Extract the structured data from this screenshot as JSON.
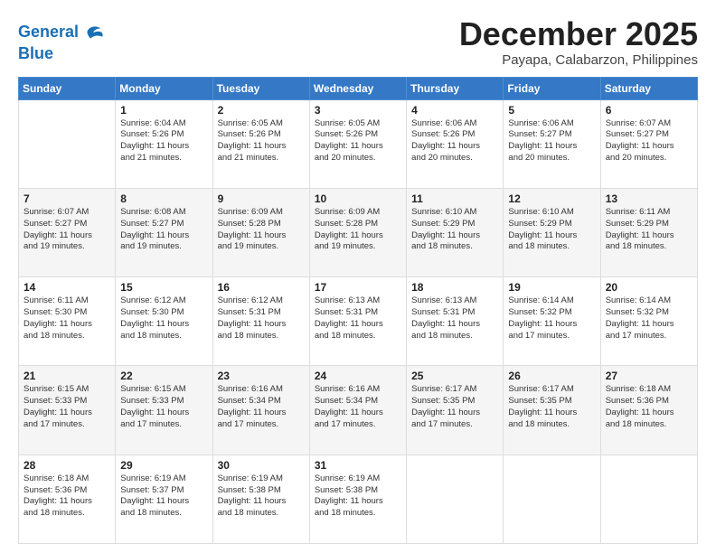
{
  "header": {
    "logo_line1": "General",
    "logo_line2": "Blue",
    "month": "December 2025",
    "location": "Payapa, Calabarzon, Philippines"
  },
  "days_of_week": [
    "Sunday",
    "Monday",
    "Tuesday",
    "Wednesday",
    "Thursday",
    "Friday",
    "Saturday"
  ],
  "weeks": [
    [
      {
        "day": "",
        "info": ""
      },
      {
        "day": "1",
        "info": "Sunrise: 6:04 AM\nSunset: 5:26 PM\nDaylight: 11 hours\nand 21 minutes."
      },
      {
        "day": "2",
        "info": "Sunrise: 6:05 AM\nSunset: 5:26 PM\nDaylight: 11 hours\nand 21 minutes."
      },
      {
        "day": "3",
        "info": "Sunrise: 6:05 AM\nSunset: 5:26 PM\nDaylight: 11 hours\nand 20 minutes."
      },
      {
        "day": "4",
        "info": "Sunrise: 6:06 AM\nSunset: 5:26 PM\nDaylight: 11 hours\nand 20 minutes."
      },
      {
        "day": "5",
        "info": "Sunrise: 6:06 AM\nSunset: 5:27 PM\nDaylight: 11 hours\nand 20 minutes."
      },
      {
        "day": "6",
        "info": "Sunrise: 6:07 AM\nSunset: 5:27 PM\nDaylight: 11 hours\nand 20 minutes."
      }
    ],
    [
      {
        "day": "7",
        "info": "Sunrise: 6:07 AM\nSunset: 5:27 PM\nDaylight: 11 hours\nand 19 minutes."
      },
      {
        "day": "8",
        "info": "Sunrise: 6:08 AM\nSunset: 5:27 PM\nDaylight: 11 hours\nand 19 minutes."
      },
      {
        "day": "9",
        "info": "Sunrise: 6:09 AM\nSunset: 5:28 PM\nDaylight: 11 hours\nand 19 minutes."
      },
      {
        "day": "10",
        "info": "Sunrise: 6:09 AM\nSunset: 5:28 PM\nDaylight: 11 hours\nand 19 minutes."
      },
      {
        "day": "11",
        "info": "Sunrise: 6:10 AM\nSunset: 5:29 PM\nDaylight: 11 hours\nand 18 minutes."
      },
      {
        "day": "12",
        "info": "Sunrise: 6:10 AM\nSunset: 5:29 PM\nDaylight: 11 hours\nand 18 minutes."
      },
      {
        "day": "13",
        "info": "Sunrise: 6:11 AM\nSunset: 5:29 PM\nDaylight: 11 hours\nand 18 minutes."
      }
    ],
    [
      {
        "day": "14",
        "info": "Sunrise: 6:11 AM\nSunset: 5:30 PM\nDaylight: 11 hours\nand 18 minutes."
      },
      {
        "day": "15",
        "info": "Sunrise: 6:12 AM\nSunset: 5:30 PM\nDaylight: 11 hours\nand 18 minutes."
      },
      {
        "day": "16",
        "info": "Sunrise: 6:12 AM\nSunset: 5:31 PM\nDaylight: 11 hours\nand 18 minutes."
      },
      {
        "day": "17",
        "info": "Sunrise: 6:13 AM\nSunset: 5:31 PM\nDaylight: 11 hours\nand 18 minutes."
      },
      {
        "day": "18",
        "info": "Sunrise: 6:13 AM\nSunset: 5:31 PM\nDaylight: 11 hours\nand 18 minutes."
      },
      {
        "day": "19",
        "info": "Sunrise: 6:14 AM\nSunset: 5:32 PM\nDaylight: 11 hours\nand 17 minutes."
      },
      {
        "day": "20",
        "info": "Sunrise: 6:14 AM\nSunset: 5:32 PM\nDaylight: 11 hours\nand 17 minutes."
      }
    ],
    [
      {
        "day": "21",
        "info": "Sunrise: 6:15 AM\nSunset: 5:33 PM\nDaylight: 11 hours\nand 17 minutes."
      },
      {
        "day": "22",
        "info": "Sunrise: 6:15 AM\nSunset: 5:33 PM\nDaylight: 11 hours\nand 17 minutes."
      },
      {
        "day": "23",
        "info": "Sunrise: 6:16 AM\nSunset: 5:34 PM\nDaylight: 11 hours\nand 17 minutes."
      },
      {
        "day": "24",
        "info": "Sunrise: 6:16 AM\nSunset: 5:34 PM\nDaylight: 11 hours\nand 17 minutes."
      },
      {
        "day": "25",
        "info": "Sunrise: 6:17 AM\nSunset: 5:35 PM\nDaylight: 11 hours\nand 17 minutes."
      },
      {
        "day": "26",
        "info": "Sunrise: 6:17 AM\nSunset: 5:35 PM\nDaylight: 11 hours\nand 18 minutes."
      },
      {
        "day": "27",
        "info": "Sunrise: 6:18 AM\nSunset: 5:36 PM\nDaylight: 11 hours\nand 18 minutes."
      }
    ],
    [
      {
        "day": "28",
        "info": "Sunrise: 6:18 AM\nSunset: 5:36 PM\nDaylight: 11 hours\nand 18 minutes."
      },
      {
        "day": "29",
        "info": "Sunrise: 6:19 AM\nSunset: 5:37 PM\nDaylight: 11 hours\nand 18 minutes."
      },
      {
        "day": "30",
        "info": "Sunrise: 6:19 AM\nSunset: 5:38 PM\nDaylight: 11 hours\nand 18 minutes."
      },
      {
        "day": "31",
        "info": "Sunrise: 6:19 AM\nSunset: 5:38 PM\nDaylight: 11 hours\nand 18 minutes."
      },
      {
        "day": "",
        "info": ""
      },
      {
        "day": "",
        "info": ""
      },
      {
        "day": "",
        "info": ""
      }
    ]
  ]
}
